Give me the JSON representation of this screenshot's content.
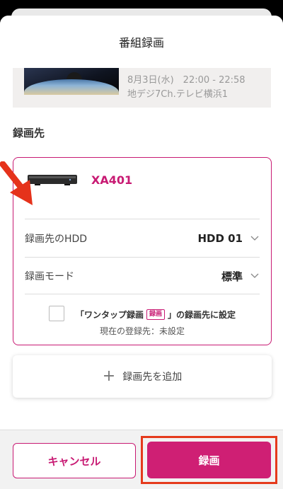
{
  "header": {
    "title": "番組録画"
  },
  "program": {
    "date_time": "8月3日(水)　22:00 - 22:58",
    "channel": "地デジ7Ch.テレビ横浜1"
  },
  "destination_section": {
    "title": "録画先"
  },
  "device": {
    "name": "XA401",
    "hdd_label": "録画先のHDD",
    "hdd_value": "HDD 01",
    "mode_label": "録画モード",
    "mode_value": "標準",
    "onetap_prefix": "「ワンタップ録画",
    "onetap_badge": "録画",
    "onetap_suffix": "」の録画先に設定",
    "current_registration": "現在の登録先：未設定"
  },
  "add_destination": {
    "label": "録画先を追加"
  },
  "footer": {
    "cancel_label": "キャンセル",
    "record_label": "録画"
  },
  "colors": {
    "accent": "#c81a73",
    "record_button": "#cf1f74",
    "highlight_outline": "#e53a1c",
    "annotation_arrow": "#e5321b"
  },
  "icons": [
    "chevron-down-icon",
    "plus-icon",
    "checkbox-icon",
    "red-arrow-annotation"
  ]
}
